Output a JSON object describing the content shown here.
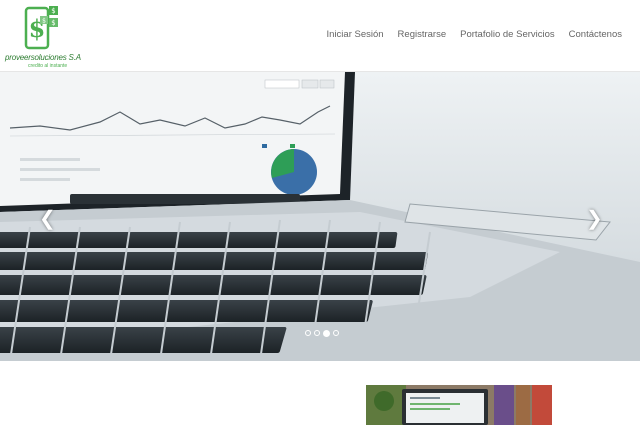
{
  "brand": {
    "name": "proveersoluciones S.A",
    "tagline": "credito al instante",
    "logo_symbol": "$",
    "logo_color": "#4caf50",
    "logo_icon": "phone-dollar-logo"
  },
  "nav": {
    "items": [
      {
        "label": "Iniciar Sesión"
      },
      {
        "label": "Registrarse"
      },
      {
        "label": "Portafolio de Servicios"
      },
      {
        "label": "Contáctenos"
      }
    ]
  },
  "carousel": {
    "prev_icon": "chevron-left-icon",
    "next_icon": "chevron-right-icon",
    "prev_glyph": "❮",
    "next_glyph": "❯",
    "slide_count": 4,
    "active_index": 2,
    "image": "laptop-analytics-photo"
  },
  "colors": {
    "accent": "#4caf50",
    "nav_text": "#666666"
  }
}
